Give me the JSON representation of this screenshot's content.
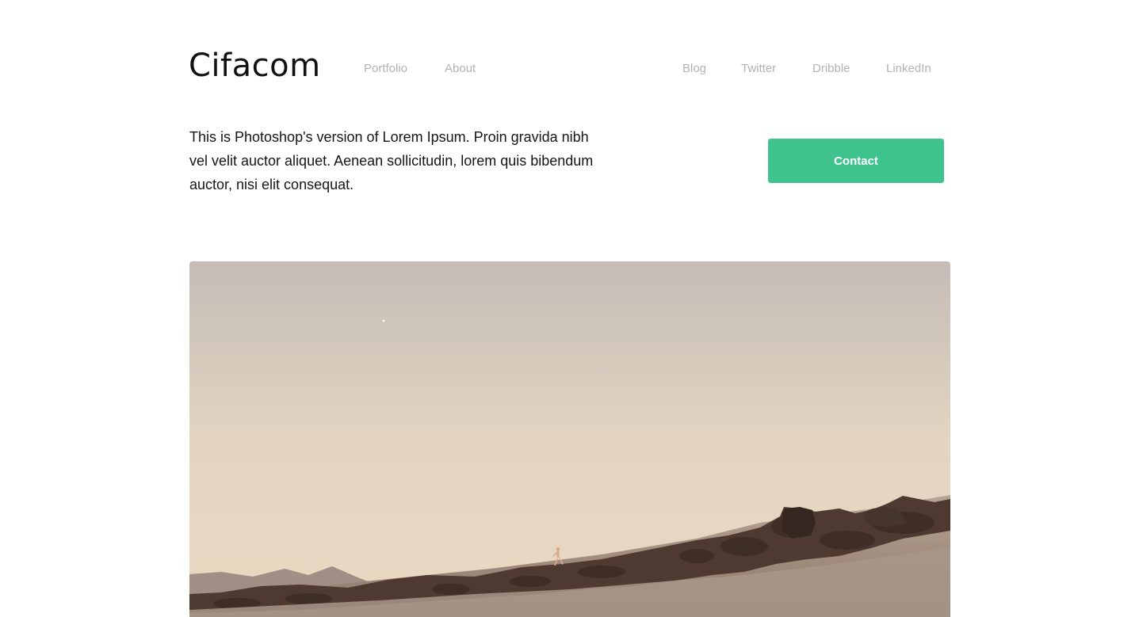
{
  "header": {
    "logo": "Cifacom",
    "nav_left": [
      "Portfolio",
      "About"
    ],
    "nav_right": [
      "Blog",
      "Twitter",
      "Dribble",
      "LinkedIn"
    ]
  },
  "intro": {
    "text": "This is Photoshop's version of Lorem Ipsum. Proin gravida nibh vel velit auctor aliquet. Aenean sollicitudin, lorem quis bibendum auctor, nisi elit consequat."
  },
  "contact": {
    "label": "Contact",
    "color": "#3fc490"
  },
  "hero": {
    "subject": "desert-landscape-photo",
    "sky_colors": [
      "#c5bcb6",
      "#e2d4c1",
      "#ead9c3"
    ]
  }
}
